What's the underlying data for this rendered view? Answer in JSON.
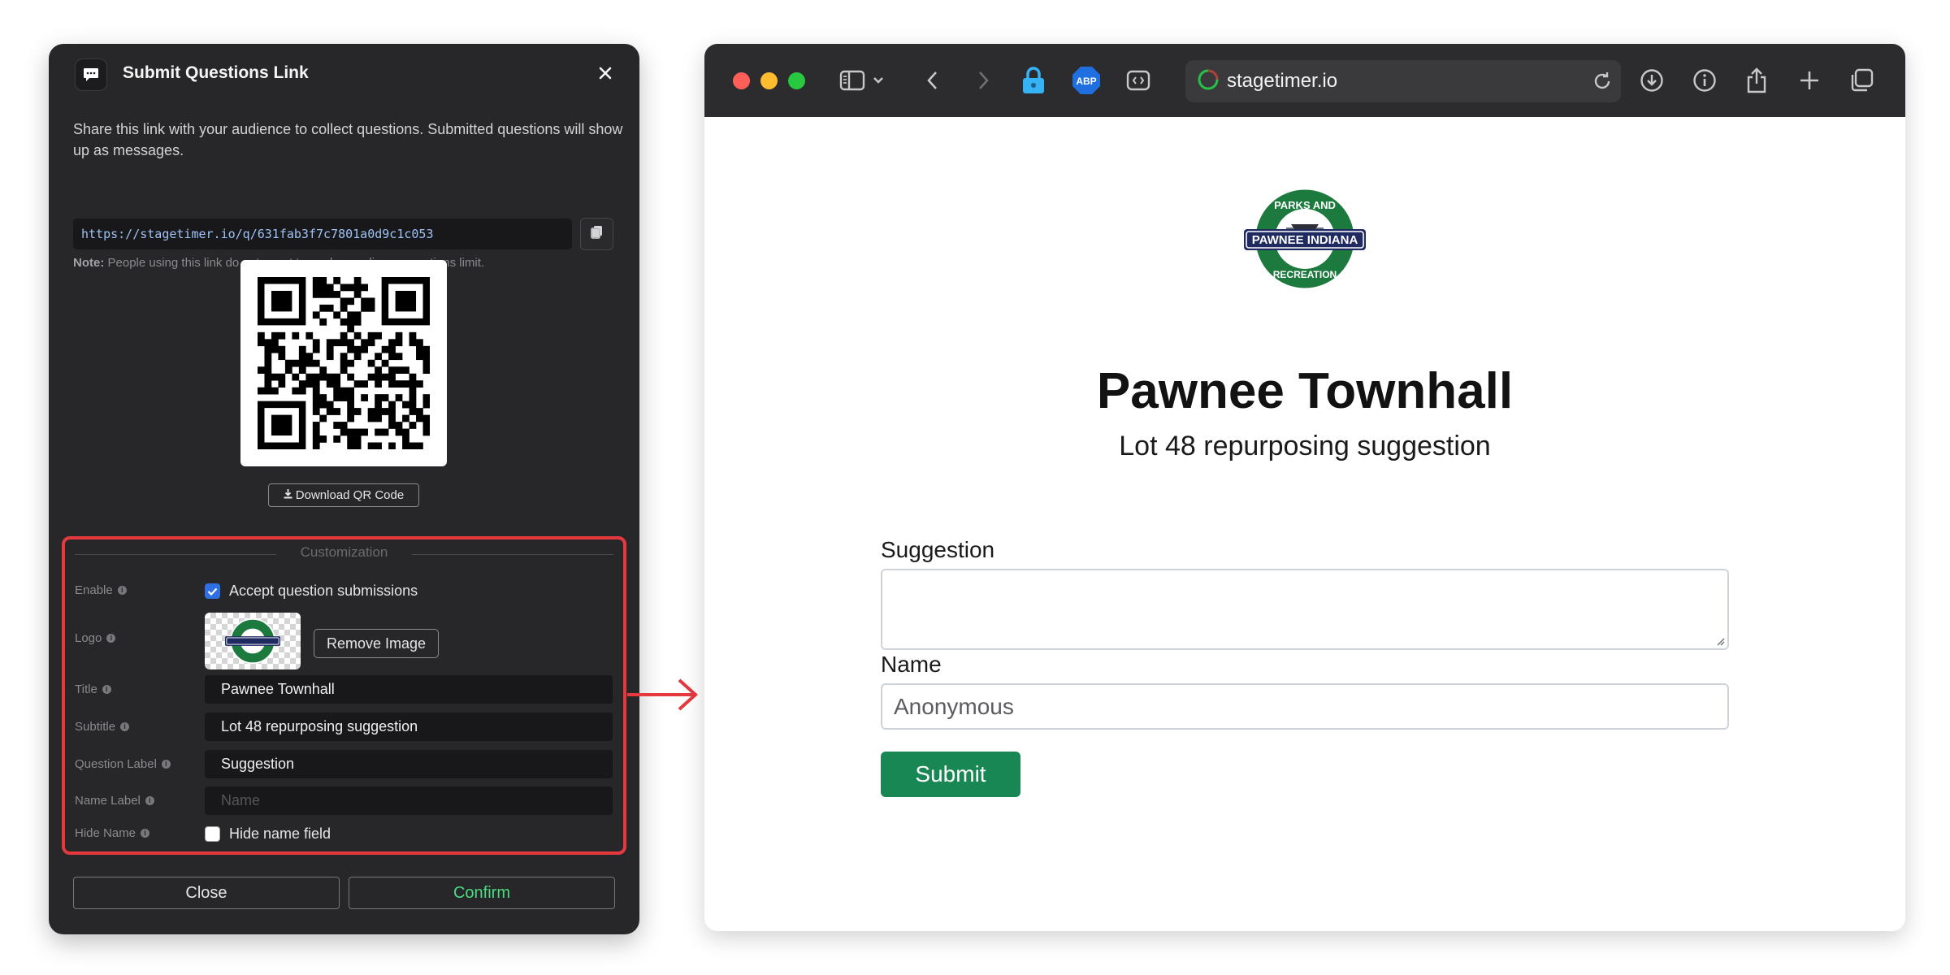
{
  "dialog": {
    "title": "Submit Questions Link",
    "description": "Share this link with your audience to collect questions. Submitted questions will show up as messages.",
    "link": "https://stagetimer.io/q/631fab3f7c7801a0d9c1c053",
    "note_label": "Note:",
    "note_text": "People using this link do not count towards your live connections limit.",
    "download_label": "Download QR Code",
    "customization": {
      "legend": "Customization",
      "enable_label": "Enable",
      "enable_checkbox_label": "Accept question submissions",
      "enable_checked": true,
      "logo_label": "Logo",
      "remove_image_label": "Remove Image",
      "title_label": "Title",
      "title_value": "Pawnee Townhall",
      "subtitle_label": "Subtitle",
      "subtitle_value": "Lot 48 repurposing suggestion",
      "question_label_label": "Question Label",
      "question_label_value": "Suggestion",
      "name_label_label": "Name Label",
      "name_label_placeholder": "Name",
      "hide_name_label": "Hide Name",
      "hide_name_checkbox_label": "Hide name field",
      "hide_name_checked": false
    },
    "close_label": "Close",
    "confirm_label": "Confirm"
  },
  "browser": {
    "url": "stagetimer.io",
    "extensions": [
      "lock-extension-icon",
      "adblock-icon",
      "code-extension-icon"
    ],
    "adblock_label": "ABP"
  },
  "page": {
    "logo_text_top": "PARKS AND",
    "logo_text_middle": "PAWNEE INDIANA",
    "logo_text_bottom": "RECREATION",
    "title": "Pawnee Townhall",
    "subtitle": "Lot 48 repurposing suggestion",
    "suggestion_label": "Suggestion",
    "name_label": "Name",
    "name_value": "Anonymous",
    "submit_label": "Submit"
  },
  "colors": {
    "highlight_border": "#e5393f",
    "submit_green": "#198754",
    "confirm_text": "#4ade80",
    "checkbox_blue": "#2f6fe4"
  }
}
